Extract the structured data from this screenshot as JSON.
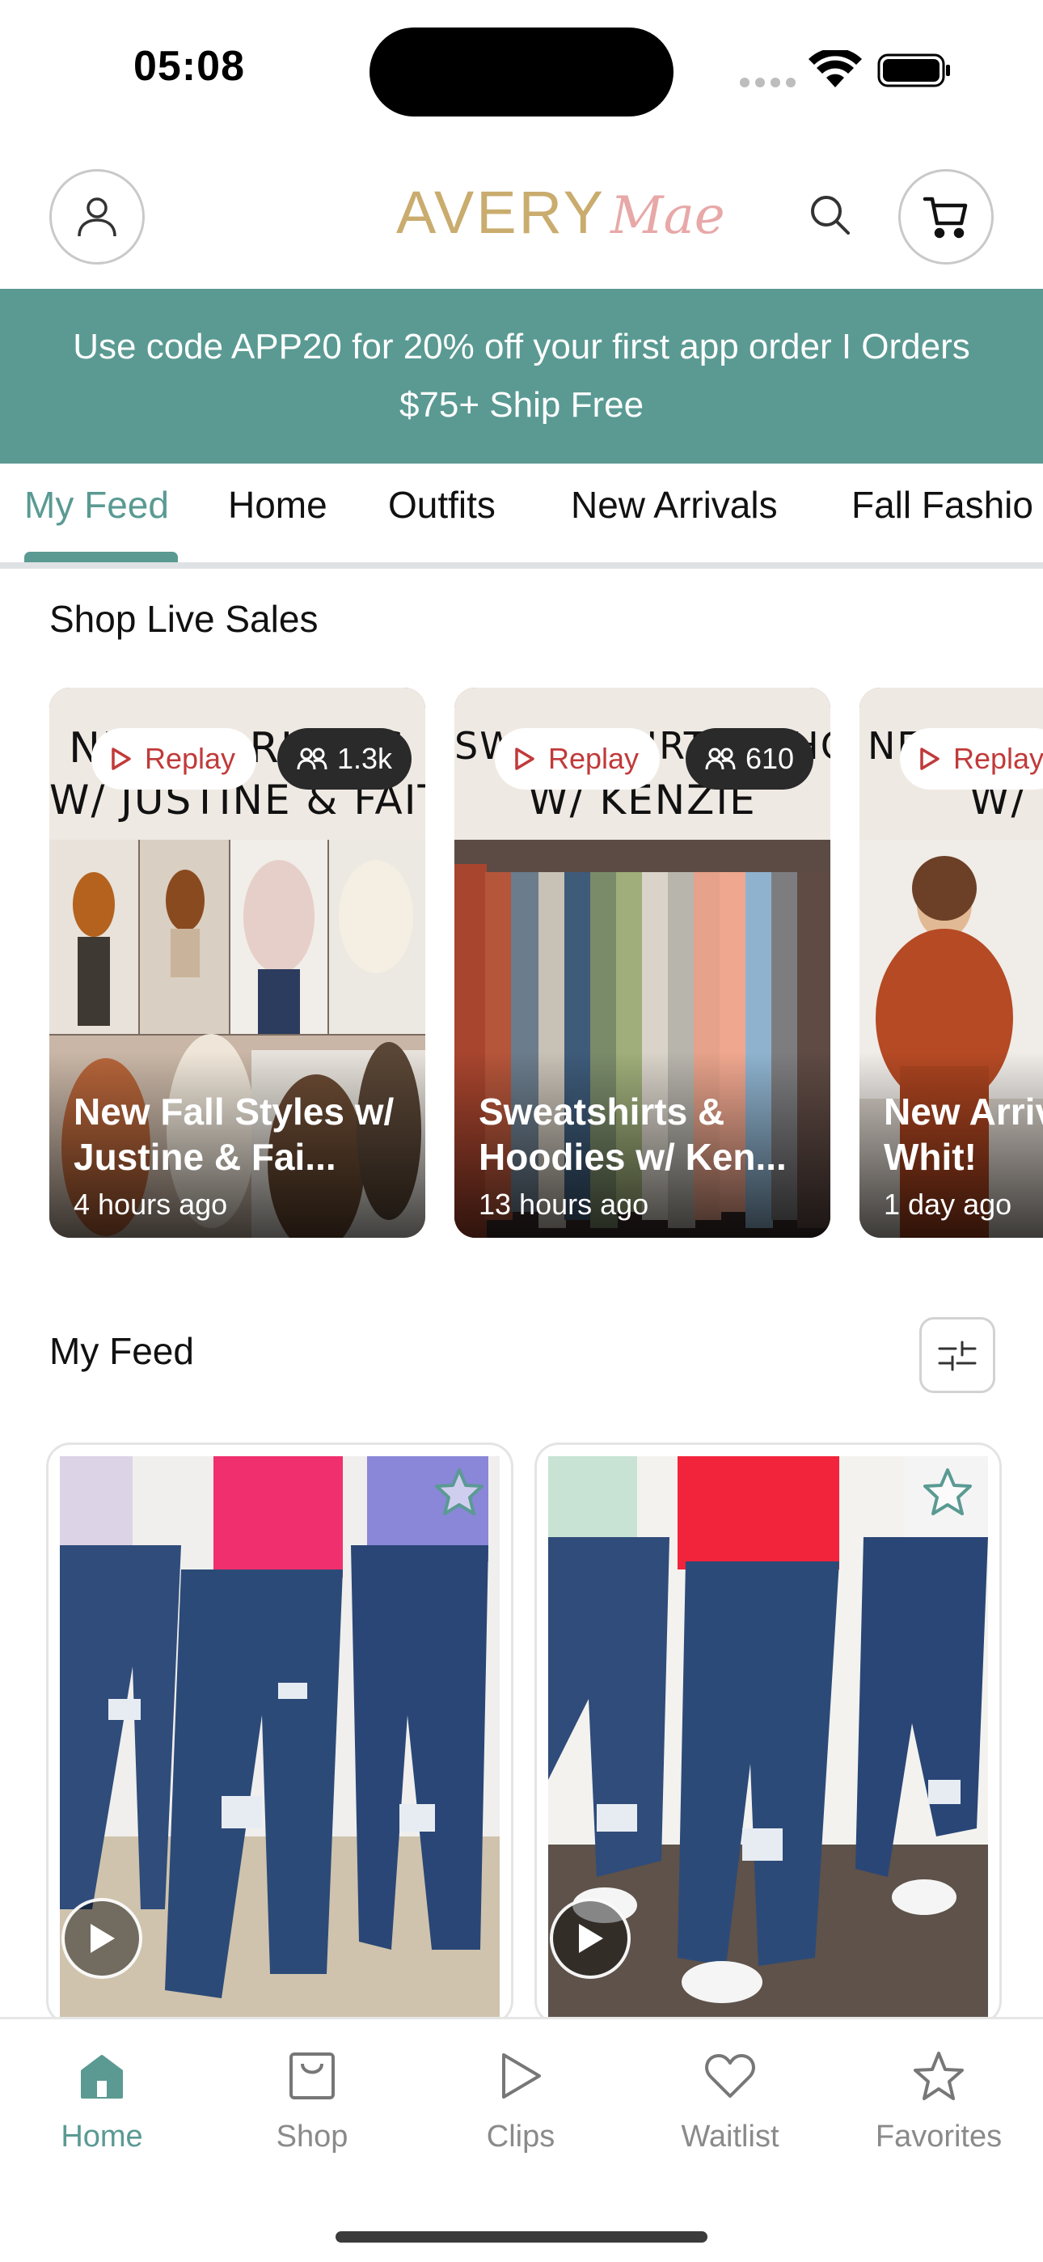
{
  "status_bar": {
    "time": "05:08"
  },
  "header": {
    "logo_main": "AVERY",
    "logo_script": "Mae",
    "account_icon": "user-icon",
    "search_icon": "search-icon",
    "cart_icon": "cart-icon"
  },
  "promo": {
    "text": "Use code APP20 for 20% off your first app order  I Orders $75+ Ship Free"
  },
  "tabs": {
    "items": [
      {
        "label": "My Feed"
      },
      {
        "label": "Home"
      },
      {
        "label": "Outfits"
      },
      {
        "label": "New Arrivals"
      },
      {
        "label": "Fall Fashio"
      }
    ],
    "active": "My Feed"
  },
  "live_sales": {
    "title": "Shop Live Sales",
    "cards": [
      {
        "header_text_1": "NEW ARRIVALS",
        "header_text_2": "W/ JUSTINE & FAITH",
        "replay_label": "Replay",
        "viewers": "1.3k",
        "title": "New Fall Styles w/ Justine & Fai...",
        "time": "4 hours ago"
      },
      {
        "header_text_1": "SWEATSHIRTS & HOODIES",
        "header_text_2": "W/ KENZIE",
        "replay_label": "Replay",
        "viewers": "610",
        "title": "Sweatshirts & Hoodies w/ Ken...",
        "time": "13 hours ago"
      },
      {
        "header_text_1": "NEW ARRIVALS",
        "header_text_2": "W/ WHIT",
        "replay_label": "Replay",
        "title": "New Arrivals w/ Whit!",
        "time": "1 day ago"
      }
    ]
  },
  "feed": {
    "title": "My Feed",
    "filter_icon": "sliders-icon",
    "products": [
      {
        "favorite_icon": "star-icon",
        "play_icon": "play-icon"
      },
      {
        "favorite_icon": "star-icon",
        "play_icon": "play-icon"
      }
    ]
  },
  "bottom_nav": {
    "items": [
      {
        "label": "Home",
        "icon": "home-icon"
      },
      {
        "label": "Shop",
        "icon": "shopping-bag-icon"
      },
      {
        "label": "Clips",
        "icon": "play-icon"
      },
      {
        "label": "Waitlist",
        "icon": "heart-icon"
      },
      {
        "label": "Favorites",
        "icon": "star-icon"
      }
    ],
    "active": "Home"
  },
  "colors": {
    "accent": "#5a9a93",
    "replay_red": "#c13a3a",
    "logo_gold": "#c9ac6e",
    "logo_pink": "#e8a8a8"
  }
}
